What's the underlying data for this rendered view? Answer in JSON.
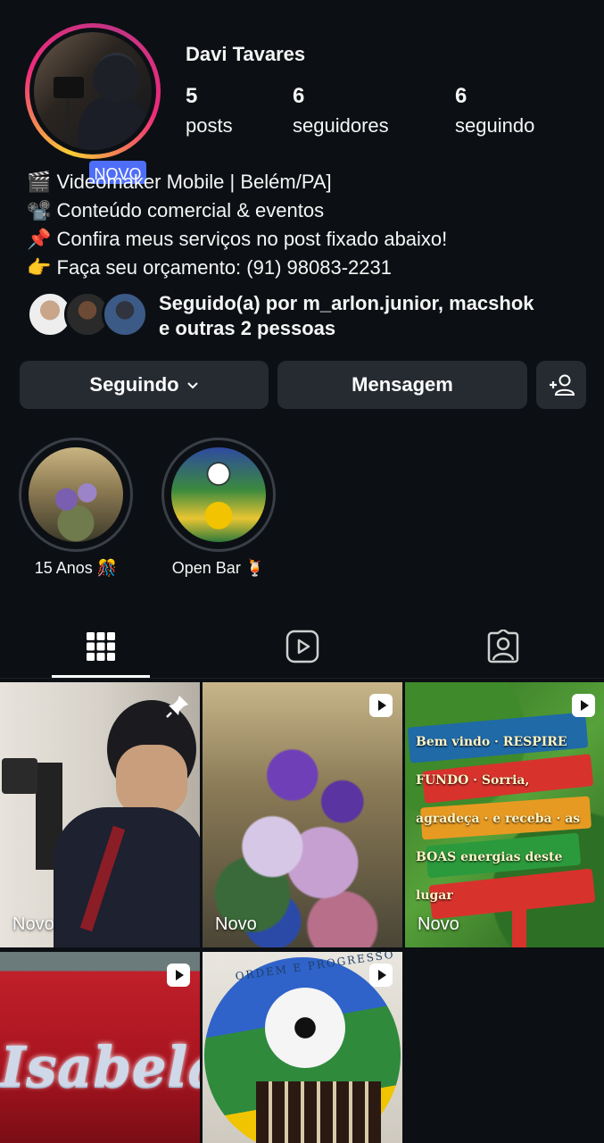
{
  "profile": {
    "username": "Davi Tavares",
    "badge": "NOVO",
    "stats": [
      {
        "value": "5",
        "label": "posts"
      },
      {
        "value": "6",
        "label": "seguidores"
      },
      {
        "value": "6",
        "label": "seguindo"
      }
    ],
    "bio": [
      "🎬 Videomaker Mobile | Belém/PA]",
      "📽️ Conteúdo comercial & eventos",
      "📌 Confira meus serviços no post fixado abaixo!",
      "👉 Faça seu orçamento: (91) 98083-2231"
    ],
    "followed_by": {
      "line1": "Seguido(a) por m_arlon.junior, macshok",
      "line2": "e outras 2 pessoas"
    }
  },
  "actions": {
    "following_label": "Seguindo",
    "message_label": "Mensagem"
  },
  "highlights": [
    {
      "label": "15 Anos 🎊"
    },
    {
      "label": "Open Bar 🍹"
    }
  ],
  "tabs": [
    "grid-icon",
    "reels-icon",
    "tagged-icon"
  ],
  "posts": [
    {
      "tag": "Novo",
      "icon": "pin-icon",
      "sign": ""
    },
    {
      "tag": "Novo",
      "icon": "reel-icon",
      "sign": ""
    },
    {
      "tag": "Novo",
      "icon": "reel-icon",
      "sign": "Bem vindo · RESPIRE FUNDO · Sorria, agradeça · e receba · as BOAS energias deste lugar"
    },
    {
      "tag": "",
      "icon": "reel-icon",
      "sign": "Isabela"
    },
    {
      "tag": "",
      "icon": "reel-icon",
      "sign": "ORDEM E PROGRESSO"
    }
  ],
  "colors": {
    "background": "#0c1014",
    "button": "#262a31",
    "badge": "#4f6ef7"
  }
}
